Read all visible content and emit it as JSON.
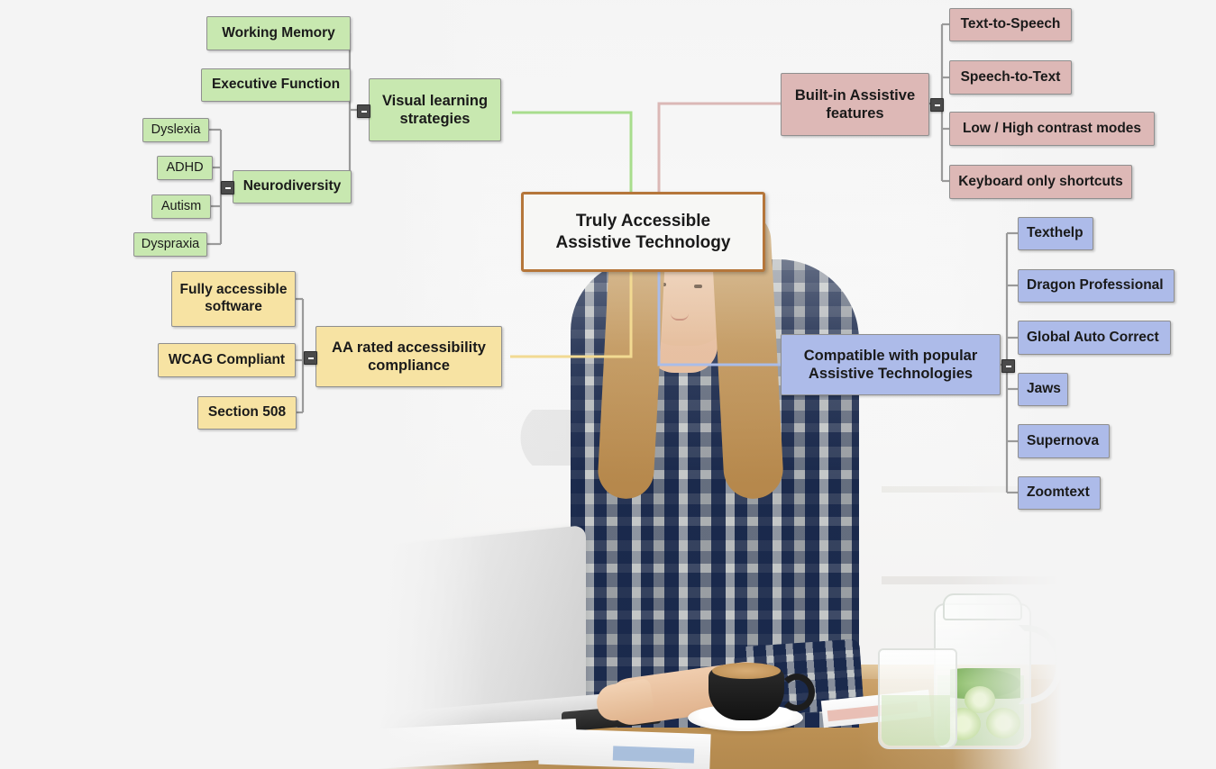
{
  "background": {
    "scene_description": "Faded photograph of a woman with long blonde hair in a plaid flannel shirt typing on a white laptop at a wooden desk, with a black coffee cup on a saucer, papers, a drinking glass and a glass pitcher of cucumber-mint water",
    "page_bg": "#f4f4f4"
  },
  "mindmap": {
    "central": {
      "line1": "Truly Accessible",
      "line2": "Assistive Technology",
      "border_color": "#b5763a",
      "fill_color": "#f7f7f5"
    },
    "branches": [
      {
        "id": "visual-learning-strategies",
        "label": "Visual learning strategies",
        "label_line1": "Visual learning",
        "label_line2": "strategies",
        "color": "#c8e8b0",
        "connector_color": "#a8dd8d",
        "side": "left",
        "children": [
          {
            "label": "Working Memory",
            "children": []
          },
          {
            "label": "Executive Function",
            "children": []
          },
          {
            "label": "Neurodiversity",
            "children": [
              {
                "label": "Dyslexia"
              },
              {
                "label": "ADHD"
              },
              {
                "label": "Autism"
              },
              {
                "label": "Dyspraxia"
              }
            ]
          }
        ]
      },
      {
        "id": "aa-rated-accessibility-compliance",
        "label": "AA rated accessibility compliance",
        "label_line1": "AA rated accessibility",
        "label_line2": "compliance",
        "color": "#f7e3a3",
        "connector_color": "#f2da92",
        "side": "left",
        "children": [
          {
            "label": "Fully accessible software",
            "label_line1": "Fully accessible",
            "label_line2": "software",
            "children": []
          },
          {
            "label": "WCAG Compliant",
            "children": []
          },
          {
            "label": "Section 508",
            "children": []
          }
        ]
      },
      {
        "id": "built-in-assistive-features",
        "label": "Built-in Assistive features",
        "label_line1": "Built-in Assistive",
        "label_line2": "features",
        "color": "#ddb8b6",
        "connector_color": "#dbb8b6",
        "side": "right",
        "children": [
          {
            "label": "Text-to-Speech",
            "children": []
          },
          {
            "label": "Speech-to-Text",
            "children": []
          },
          {
            "label": "Low / High contrast modes",
            "children": []
          },
          {
            "label": "Keyboard only shortcuts",
            "children": []
          }
        ]
      },
      {
        "id": "compatible-with-popular-assistive-technologies",
        "label": "Compatible with popular Assistive Technologies",
        "label_line1": "Compatible with popular",
        "label_line2": "Assistive Technologies",
        "color": "#adbbe9",
        "connector_color": "#a9bce8",
        "side": "right",
        "children": [
          {
            "label": "Texthelp",
            "children": []
          },
          {
            "label": "Dragon Professional",
            "children": []
          },
          {
            "label": "Global Auto Correct",
            "children": []
          },
          {
            "label": "Jaws",
            "children": []
          },
          {
            "label": "Supernova",
            "children": []
          },
          {
            "label": "Zoomtext",
            "children": []
          }
        ]
      }
    ],
    "collapse_icon": "minus-square"
  }
}
